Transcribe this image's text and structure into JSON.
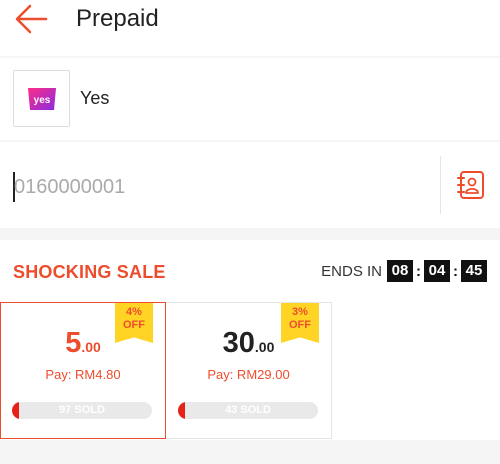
{
  "header": {
    "title": "Prepaid"
  },
  "operator": {
    "name": "Yes",
    "logo_text": "yes"
  },
  "phone": {
    "placeholder": "0160000001"
  },
  "sale": {
    "title": "SHOCKING SALE",
    "ends_label": "ENDS IN",
    "timer": {
      "hours": "08",
      "minutes": "04",
      "seconds": "45"
    },
    "cards": [
      {
        "discount_pct": "4%",
        "discount_label": "OFF",
        "amount_main": "5",
        "amount_decimals": ".00",
        "pay": "Pay: RM4.80",
        "sold": "97 SOLD",
        "sold_fraction": 0.05
      },
      {
        "discount_pct": "3%",
        "discount_label": "OFF",
        "amount_main": "30",
        "amount_decimals": ".00",
        "pay": "Pay: RM29.00",
        "sold": "43 SOLD",
        "sold_fraction": 0.05
      }
    ]
  },
  "colors": {
    "accent": "#ee4d2d",
    "badge": "#ffd424",
    "brand_magenta": "#d1006e"
  },
  "icons": {
    "back": "arrow-left-icon",
    "contact": "contact-book-icon"
  }
}
